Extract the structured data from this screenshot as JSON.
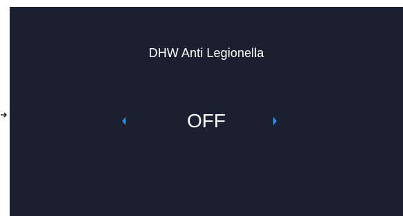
{
  "screen": {
    "title": "DHW Anti Legionella",
    "value": "OFF",
    "prev_icon": "caret-left-icon",
    "next_icon": "caret-right-icon",
    "external_indicator_icon": "arrow-right-icon"
  },
  "colors": {
    "background": "#1b2030",
    "text": "#ffffff",
    "accent": "#1e90ff"
  }
}
